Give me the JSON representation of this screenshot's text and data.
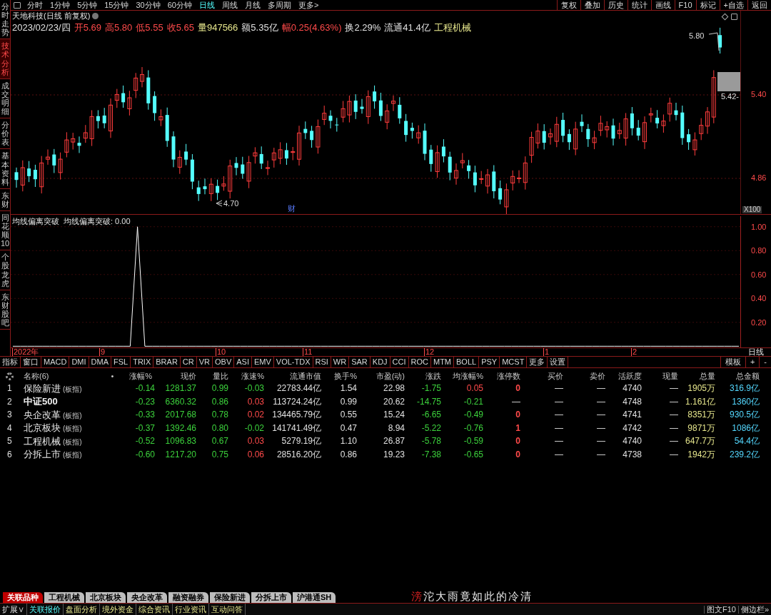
{
  "side_tabs": [
    {
      "label": "分时走势",
      "selected": false
    },
    {
      "label": "技术分析",
      "selected": true
    },
    {
      "label": "成交明细",
      "selected": false
    },
    {
      "label": "分价表",
      "selected": false
    },
    {
      "label": "基本资料",
      "selected": false
    },
    {
      "label": "东财",
      "selected": false
    },
    {
      "label": "同花顺10",
      "selected": false
    },
    {
      "label": "个股龙虎",
      "selected": false
    },
    {
      "label": "东财股吧",
      "selected": false
    }
  ],
  "toolbar": {
    "periods": [
      {
        "label": "分时",
        "selected": false
      },
      {
        "label": "1分钟",
        "selected": false
      },
      {
        "label": "5分钟",
        "selected": false
      },
      {
        "label": "15分钟",
        "selected": false
      },
      {
        "label": "30分钟",
        "selected": false
      },
      {
        "label": "60分钟",
        "selected": false
      },
      {
        "label": "日线",
        "selected": true
      },
      {
        "label": "周线",
        "selected": false
      },
      {
        "label": "月线",
        "selected": false
      },
      {
        "label": "多周期",
        "selected": false
      },
      {
        "label": "更多>",
        "selected": false
      }
    ],
    "actions": [
      "复权",
      "叠加",
      "历史",
      "统计",
      "画线",
      "F10",
      "标记",
      "+自选",
      "返回"
    ]
  },
  "stock": {
    "title": "天地科技(日线 前复权)",
    "quote": [
      {
        "value": "2023/02/23/四",
        "color": "#e0e0e0"
      },
      {
        "label": "开",
        "value": "5.69",
        "color": "#ff4a4a"
      },
      {
        "label": "高",
        "value": "5.80",
        "color": "#ff4a4a"
      },
      {
        "label": "低",
        "value": "5.55",
        "color": "#ff4a4a"
      },
      {
        "label": "收",
        "value": "5.65",
        "color": "#ff4a4a"
      },
      {
        "label": "量",
        "value": "947566",
        "color": "#e6e68c"
      },
      {
        "label": "额",
        "value": "5.35亿",
        "color": "#e0e0e0"
      },
      {
        "label": "幅",
        "value": "0.25(4.63%)",
        "color": "#ff4a4a"
      },
      {
        "label": "换",
        "value": "2.29%",
        "color": "#e0e0e0"
      },
      {
        "label": "流通",
        "value": "41.4亿",
        "color": "#e0e0e0"
      },
      {
        "value": "工程机械",
        "color": "#e6e68c"
      }
    ]
  },
  "main_chart": {
    "high_label": "5.80",
    "low_label": "4.70",
    "marker": "财",
    "axis": [
      "5.40",
      "4.86"
    ],
    "price_tag": "5.42-",
    "scale": "X100"
  },
  "indicator": {
    "title": "均线偏离突破",
    "reading": "均线偏离突破: 0.00",
    "chart_data": {
      "type": "line",
      "ylim": [
        -0.01,
        1.1
      ],
      "grid": true,
      "yticks": [
        {
          "value": 0.2,
          "label": "0.20"
        },
        {
          "value": 0.4,
          "label": "0.40"
        },
        {
          "value": 0.6,
          "label": "0.60"
        },
        {
          "value": 0.8,
          "label": "0.80"
        },
        {
          "value": 1,
          "label": "1.00"
        }
      ],
      "series": [
        {
          "color": "#ffffff",
          "values": [
            0,
            0,
            0,
            0,
            0,
            0,
            0,
            0,
            0,
            0,
            0,
            0,
            0,
            0,
            0,
            0,
            0,
            1,
            0,
            0,
            0,
            0,
            0,
            0,
            0,
            0,
            0,
            0,
            0,
            0,
            0,
            0,
            0,
            0,
            0,
            0,
            0,
            0,
            0,
            0,
            0,
            0,
            0,
            0,
            0,
            0,
            0,
            0,
            0,
            0,
            0,
            0,
            0,
            0,
            0,
            0,
            0,
            0,
            0,
            0,
            0,
            0,
            0,
            0,
            0,
            0,
            0,
            0,
            0,
            0,
            0,
            0,
            0,
            0,
            0,
            0,
            0,
            0,
            0,
            0,
            0,
            0,
            0,
            0,
            0,
            0,
            0,
            0,
            0,
            0,
            0,
            0,
            0,
            0,
            0,
            0,
            0,
            0,
            0,
            0
          ]
        }
      ]
    }
  },
  "date_axis": {
    "labels": [
      "2022年",
      "9",
      "10",
      "11",
      "12",
      "1",
      "2"
    ],
    "period": "日线"
  },
  "indicator_tabs": [
    "指标",
    "窗口",
    "MACD",
    "DMI",
    "DMA",
    "FSL",
    "TRIX",
    "BRAR",
    "CR",
    "VR",
    "OBV",
    "ASI",
    "EMV",
    "VOL-TDX",
    "RSI",
    "WR",
    "SAR",
    "KDJ",
    "CCI",
    "ROC",
    "MTM",
    "BOLL",
    "PSY",
    "MCST",
    "更多",
    "设置"
  ],
  "indicator_tools": [
    "模板",
    "+",
    "-"
  ],
  "table": {
    "count_label": "名称(6)",
    "dot": "•",
    "columns": [
      "涨幅%",
      "现价",
      "量比",
      "涨速%",
      "流通市值",
      "换手%",
      "市盈(动)",
      "涨跌",
      "均涨幅%",
      "涨停数",
      "买价",
      "卖价",
      "活跃度",
      "现量",
      "总量",
      "总金额"
    ],
    "rows": [
      {
        "index": "1",
        "name": "保险新进",
        "tag": "(板指)",
        "cells": [
          {
            "text": "-0.14",
            "color": "#3cd23c"
          },
          {
            "text": "1281.37",
            "color": "#3cd23c"
          },
          {
            "text": "0.99",
            "color": "#3cd23c"
          },
          {
            "text": "-0.03",
            "color": "#3cd23c"
          },
          "22783.44亿",
          "1.54",
          "22.98",
          {
            "text": "-1.75",
            "color": "#3cd23c"
          },
          {
            "text": "0.05",
            "color": "#ff4a4a"
          },
          {
            "text": "0",
            "color": "#ff4a4a"
          },
          "—",
          "—",
          "4740",
          "—",
          "1905万",
          "316.9亿"
        ]
      },
      {
        "index": "2",
        "name": "中证500",
        "cells": [
          {
            "text": "-0.23",
            "color": "#3cd23c"
          },
          {
            "text": "6360.32",
            "color": "#3cd23c"
          },
          {
            "text": "0.86",
            "color": "#3cd23c"
          },
          {
            "text": "0.03",
            "color": "#ff4a4a"
          },
          "113724.24亿",
          "0.99",
          "20.62",
          {
            "text": "-14.75",
            "color": "#3cd23c"
          },
          {
            "text": "-0.21",
            "color": "#3cd23c"
          },
          "—",
          "—",
          "—",
          "4748",
          "—",
          "1.161亿",
          "1360亿"
        ]
      },
      {
        "index": "3",
        "name": "央企改革",
        "tag": "(板指)",
        "cells": [
          {
            "text": "-0.33",
            "color": "#3cd23c"
          },
          {
            "text": "2017.68",
            "color": "#3cd23c"
          },
          {
            "text": "0.78",
            "color": "#3cd23c"
          },
          {
            "text": "0.02",
            "color": "#ff4a4a"
          },
          "134465.79亿",
          "0.55",
          "15.24",
          {
            "text": "-6.65",
            "color": "#3cd23c"
          },
          {
            "text": "-0.49",
            "color": "#3cd23c"
          },
          {
            "text": "0",
            "color": "#ff4a4a"
          },
          "—",
          "—",
          "4741",
          "—",
          "8351万",
          "930.5亿"
        ]
      },
      {
        "index": "4",
        "name": "北京板块",
        "tag": "(板指)",
        "cells": [
          {
            "text": "-0.37",
            "color": "#3cd23c"
          },
          {
            "text": "1392.46",
            "color": "#3cd23c"
          },
          {
            "text": "0.80",
            "color": "#3cd23c"
          },
          {
            "text": "-0.02",
            "color": "#3cd23c"
          },
          "141741.49亿",
          "0.47",
          "8.94",
          {
            "text": "-5.22",
            "color": "#3cd23c"
          },
          {
            "text": "-0.76",
            "color": "#3cd23c"
          },
          {
            "text": "1",
            "color": "#ff4a4a"
          },
          "—",
          "—",
          "4742",
          "—",
          "9871万",
          "1086亿"
        ]
      },
      {
        "index": "5",
        "name": "工程机械",
        "tag": "(板指)",
        "cells": [
          {
            "text": "-0.52",
            "color": "#3cd23c"
          },
          {
            "text": "1096.83",
            "color": "#3cd23c"
          },
          {
            "text": "0.67",
            "color": "#3cd23c"
          },
          {
            "text": "0.03",
            "color": "#ff4a4a"
          },
          "5279.19亿",
          "1.10",
          "26.87",
          {
            "text": "-5.78",
            "color": "#3cd23c"
          },
          {
            "text": "-0.59",
            "color": "#3cd23c"
          },
          {
            "text": "0",
            "color": "#ff4a4a"
          },
          "—",
          "—",
          "4740",
          "—",
          "647.7万",
          "54.4亿"
        ]
      },
      {
        "index": "6",
        "name": "分拆上市",
        "tag": "(板指)",
        "cells": [
          {
            "text": "-0.60",
            "color": "#3cd23c"
          },
          {
            "text": "1217.20",
            "color": "#3cd23c"
          },
          {
            "text": "0.75",
            "color": "#3cd23c"
          },
          {
            "text": "0.06",
            "color": "#ff4a4a"
          },
          "28516.20亿",
          "0.86",
          "19.23",
          {
            "text": "-7.38",
            "color": "#3cd23c"
          },
          {
            "text": "-0.65",
            "color": "#3cd23c"
          },
          {
            "text": "0",
            "color": "#ff4a4a"
          },
          "—",
          "—",
          "4738",
          "—",
          "1942万",
          "239.2亿"
        ]
      }
    ]
  },
  "bottom_tabs": [
    {
      "label": "关联品种",
      "selected": true
    },
    {
      "label": "工程机械",
      "selected": false
    },
    {
      "label": "北京板块",
      "selected": false
    },
    {
      "label": "央企改革",
      "selected": false
    },
    {
      "label": "融资融券",
      "selected": false
    },
    {
      "label": "保险新进",
      "selected": false
    },
    {
      "label": "分拆上市",
      "selected": false
    },
    {
      "label": "沪港通SH",
      "selected": false
    }
  ],
  "ticker": {
    "lead": "滂",
    "rest": "沱大雨竟如此的冷清"
  },
  "bottom_links": [
    {
      "label": "扩展∨",
      "selected": false
    },
    {
      "label": "关联报价",
      "selected": true
    },
    {
      "label": "盘面分析",
      "selected": false
    },
    {
      "label": "境外资金",
      "selected": false
    },
    {
      "label": "综合资讯",
      "selected": false
    },
    {
      "label": "行业资讯",
      "selected": false
    },
    {
      "label": "互动问答",
      "selected": false
    }
  ],
  "status_right": [
    "图文F10",
    "侧边栏»"
  ]
}
